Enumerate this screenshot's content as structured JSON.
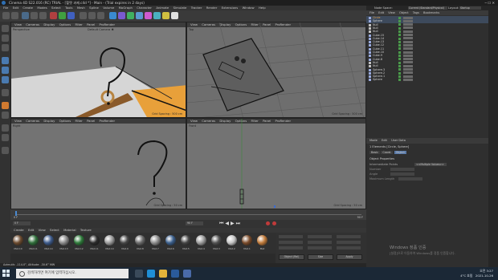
{
  "title": "Cinema 4D S22.016 (RC) TRIAL - [헬멧 과제.c4d *] - Main - (Trial expires in 2 days)",
  "menu": [
    "File",
    "Edit",
    "Create",
    "Modes",
    "Select",
    "Tools",
    "Mesh",
    "Spline",
    "Volume",
    "MoGraph",
    "Character",
    "Animate",
    "Simulate",
    "Tracker",
    "Render",
    "Extensions",
    "Window",
    "Help"
  ],
  "layout": {
    "node_space_label": "Node Space:",
    "node_space_value": "Current (Standard/Physical)",
    "layout_label": "Layout:",
    "layout_value": "Startup"
  },
  "viewport_menu": [
    "View",
    "Cameras",
    "Display",
    "Options",
    "Filter",
    "Panel",
    "ProRender"
  ],
  "viewports": [
    {
      "label": "Perspective",
      "camera": "Default Camera ✱",
      "grid": "Grid Spacing : 500 cm"
    },
    {
      "label": "Top",
      "grid": "Grid Spacing : 500 cm"
    },
    {
      "label": "Right",
      "grid": "Grid Spacing : 50 cm"
    },
    {
      "label": "Front",
      "grid": "Grid Spacing : 50 cm"
    }
  ],
  "timeline": {
    "start": "0 F",
    "end": "90 F",
    "current": "0 F",
    "end_field": "90 F"
  },
  "materials_menu": [
    "Create",
    "Edit",
    "View",
    "Select",
    "Material",
    "Texture"
  ],
  "materials": [
    {
      "name": "Mat.10",
      "color": "#6b4a2e"
    },
    {
      "name": "Mat.11",
      "color": "#2f6e3a"
    },
    {
      "name": "Mat.14",
      "color": "#3d5a8a"
    },
    {
      "name": "Mat.13",
      "color": "#8a8a8a"
    },
    {
      "name": "Mat.12",
      "color": "#2e7a3a"
    },
    {
      "name": "Mat.11",
      "color": "#2c2c2c"
    },
    {
      "name": "Mat.10",
      "color": "#9a9a9a"
    },
    {
      "name": "Mat.9",
      "color": "#454545"
    },
    {
      "name": "Mat.8",
      "color": "#6a6a6a"
    },
    {
      "name": "Mat.7",
      "color": "#8c8c8c"
    },
    {
      "name": "Mat.6",
      "color": "#3b5f8c"
    },
    {
      "name": "Mat.5",
      "color": "#444444"
    },
    {
      "name": "Mat.4",
      "color": "#9b9b9b"
    },
    {
      "name": "Mat.3",
      "color": "#525252"
    },
    {
      "name": "Mat.2",
      "color": "#c4c4c4"
    },
    {
      "name": "Mat.1",
      "color": "#7a4b2a"
    },
    {
      "name": "Mat",
      "color": "#c07a3a"
    }
  ],
  "coords": {
    "object_rel": "Object (Rel)",
    "size": "Size",
    "apply": "Apply"
  },
  "status": "Azimuth: -114.0°, Altitude: -30.6° MW",
  "objects_menu": [
    "File",
    "Edit",
    "View",
    "Object",
    "Tags",
    "Bookmarks"
  ],
  "objects": [
    "Circle",
    "Sphere",
    "Null",
    "Null",
    "Null",
    "Cube.15",
    "Cube.14",
    "Cube.13",
    "Cube.12",
    "Cube.11",
    "Cube.10",
    "Cube.9",
    "Cube.8",
    "Null",
    "Null",
    "Sphere.3",
    "Sphere.2",
    "Sphere.1",
    "Sphere"
  ],
  "attr_menu": [
    "Mode",
    "Edit",
    "User Data"
  ],
  "attributes": {
    "element": "1 Elements [Circle, Sphere]",
    "tabs": [
      "Basic",
      "Coord.",
      "Object"
    ],
    "section": "Object Properties",
    "fields": [
      {
        "label": "Intermediate Points",
        "value": "<<Multiple Values>>"
      },
      {
        "label": "Number",
        "value": ""
      },
      {
        "label": "Angle",
        "value": ""
      },
      {
        "label": "Maximum Length",
        "value": ""
      }
    ]
  },
  "watermark": {
    "line1": "Windows 정품 인증",
    "line2": "[설정]으로 이동하여 Windows를 정품 인증합니다."
  },
  "taskbar": {
    "search": "검색하려면 여기에 입력하십시오.",
    "weather": "4°C 흐림",
    "time": "오전 3:27",
    "date": "2021-10-26"
  }
}
